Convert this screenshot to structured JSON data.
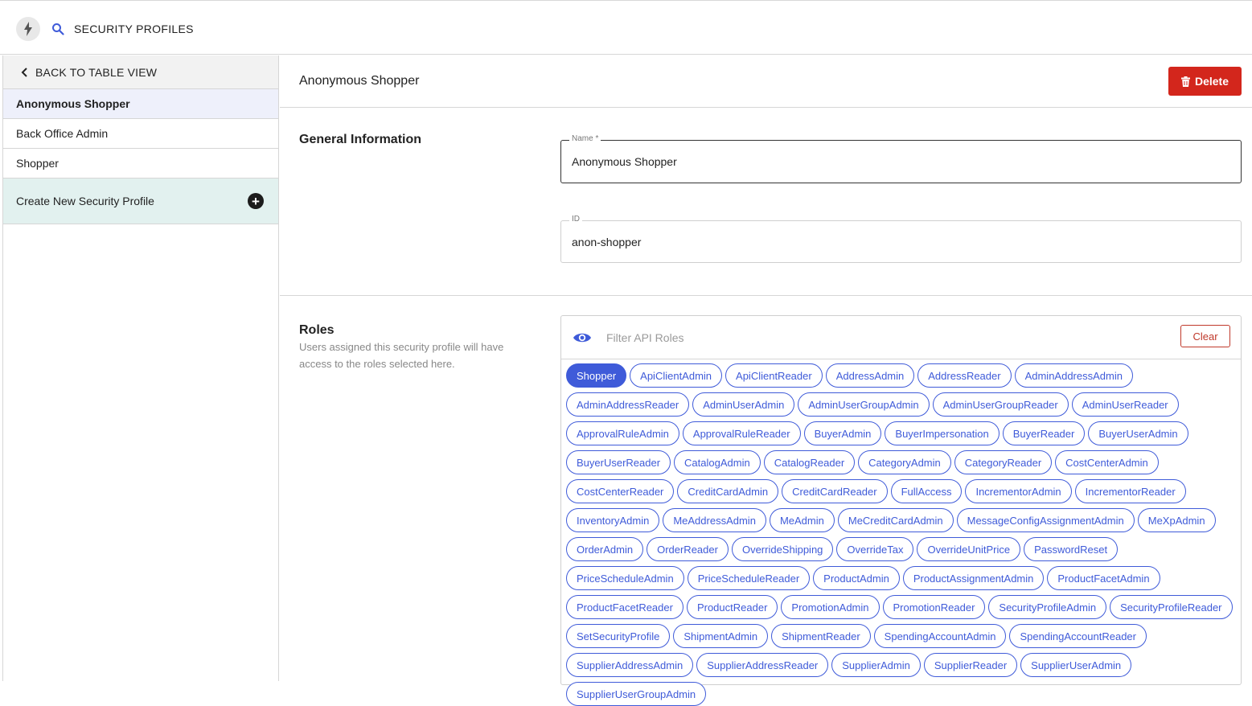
{
  "topbar": {
    "title": "SECURITY PROFILES"
  },
  "sidebar": {
    "back_label": "BACK TO TABLE VIEW",
    "items": [
      {
        "label": "Anonymous Shopper"
      },
      {
        "label": "Back Office Admin"
      },
      {
        "label": "Shopper"
      }
    ],
    "create_label": "Create New Security Profile"
  },
  "main": {
    "title": "Anonymous Shopper",
    "delete_label": "Delete"
  },
  "general": {
    "title": "General Information",
    "name_label": "Name *",
    "name_value": "Anonymous Shopper",
    "id_label": "ID",
    "id_value": "anon-shopper"
  },
  "roles": {
    "title": "Roles",
    "description": "Users assigned this security profile will have access to the roles selected here.",
    "filter_placeholder": "Filter API Roles",
    "clear_label": "Clear",
    "chips": [
      {
        "label": "Shopper",
        "selected": true
      },
      {
        "label": "ApiClientAdmin"
      },
      {
        "label": "ApiClientReader"
      },
      {
        "label": "AddressAdmin"
      },
      {
        "label": "AddressReader"
      },
      {
        "label": "AdminAddressAdmin"
      },
      {
        "label": "AdminAddressReader"
      },
      {
        "label": "AdminUserAdmin"
      },
      {
        "label": "AdminUserGroupAdmin"
      },
      {
        "label": "AdminUserGroupReader"
      },
      {
        "label": "AdminUserReader"
      },
      {
        "label": "ApprovalRuleAdmin"
      },
      {
        "label": "ApprovalRuleReader"
      },
      {
        "label": "BuyerAdmin"
      },
      {
        "label": "BuyerImpersonation"
      },
      {
        "label": "BuyerReader"
      },
      {
        "label": "BuyerUserAdmin"
      },
      {
        "label": "BuyerUserReader"
      },
      {
        "label": "CatalogAdmin"
      },
      {
        "label": "CatalogReader"
      },
      {
        "label": "CategoryAdmin"
      },
      {
        "label": "CategoryReader"
      },
      {
        "label": "CostCenterAdmin"
      },
      {
        "label": "CostCenterReader"
      },
      {
        "label": "CreditCardAdmin"
      },
      {
        "label": "CreditCardReader"
      },
      {
        "label": "FullAccess"
      },
      {
        "label": "IncrementorAdmin"
      },
      {
        "label": "IncrementorReader"
      },
      {
        "label": "InventoryAdmin"
      },
      {
        "label": "MeAddressAdmin"
      },
      {
        "label": "MeAdmin"
      },
      {
        "label": "MeCreditCardAdmin"
      },
      {
        "label": "MessageConfigAssignmentAdmin"
      },
      {
        "label": "MeXpAdmin"
      },
      {
        "label": "OrderAdmin"
      },
      {
        "label": "OrderReader"
      },
      {
        "label": "OverrideShipping"
      },
      {
        "label": "OverrideTax"
      },
      {
        "label": "OverrideUnitPrice"
      },
      {
        "label": "PasswordReset"
      },
      {
        "label": "PriceScheduleAdmin"
      },
      {
        "label": "PriceScheduleReader"
      },
      {
        "label": "ProductAdmin"
      },
      {
        "label": "ProductAssignmentAdmin"
      },
      {
        "label": "ProductFacetAdmin"
      },
      {
        "label": "ProductFacetReader"
      },
      {
        "label": "ProductReader"
      },
      {
        "label": "PromotionAdmin"
      },
      {
        "label": "PromotionReader"
      },
      {
        "label": "SecurityProfileAdmin"
      },
      {
        "label": "SecurityProfileReader"
      },
      {
        "label": "SetSecurityProfile"
      },
      {
        "label": "ShipmentAdmin"
      },
      {
        "label": "ShipmentReader"
      },
      {
        "label": "SpendingAccountAdmin"
      },
      {
        "label": "SpendingAccountReader"
      },
      {
        "label": "SupplierAddressAdmin"
      },
      {
        "label": "SupplierAddressReader"
      },
      {
        "label": "SupplierAdmin"
      },
      {
        "label": "SupplierReader"
      },
      {
        "label": "SupplierUserAdmin"
      },
      {
        "label": "SupplierUserGroupAdmin"
      }
    ]
  }
}
